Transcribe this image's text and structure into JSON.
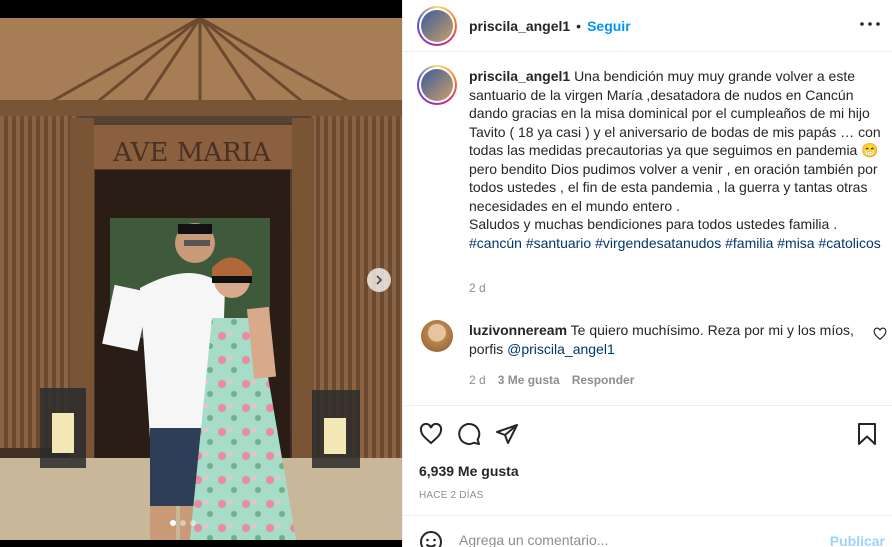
{
  "post": {
    "username": "priscila_angel1",
    "separator": "•",
    "follow_label": "Seguir",
    "caption": "Una bendición muy muy grande volver a este santuario de la virgen María ,desatadora de nudos en Cancún dando gracias en la misa dominical por el cumpleaños de mi hijo Tavito ( 18 ya casi ) y el aniversario de bodas de mis papás … con todas las medidas precautorias ya que seguimos en pandemia",
    "caption_emoji": "😁",
    "caption_cont": " pero bendito Dios pudimos volver a venir , en oración también por todos ustedes , el fin de esta pandemia , la guerra y tantas otras necesidades en el mundo entero .",
    "caption_end": "Saludos y muchas bendiciones para todos ustedes familia .",
    "hashtags": [
      "#cancún",
      "#santuario",
      "#virgendesatanudos",
      "#familia",
      "#misa",
      "#catolicos"
    ],
    "caption_time": "2 d",
    "sign_text": "AVE MARIA"
  },
  "comment": {
    "username": "luzivonneream",
    "text": "Te quiero muchísimo. Reza por mi y los míos, porfis",
    "mention": "@priscila_angel1",
    "time": "2 d",
    "likes": "3 Me gusta",
    "reply_label": "Responder"
  },
  "stats": {
    "likes": "6,939 Me gusta",
    "ago": "HACE 2 DÍAS"
  },
  "composer": {
    "placeholder": "Agrega un comentario...",
    "post_label": "Publicar"
  },
  "carousel": {
    "slides": 3,
    "active": 0
  },
  "icons": {
    "more": "more-horizontal-icon",
    "like": "heart-icon",
    "comment": "comment-bubble-icon",
    "share": "paper-plane-icon",
    "save": "bookmark-icon",
    "emoji": "smiley-icon",
    "next": "chevron-right-icon"
  },
  "colors": {
    "accent": "#0095f6",
    "link": "#00376b",
    "muted": "#8e8e8e"
  }
}
